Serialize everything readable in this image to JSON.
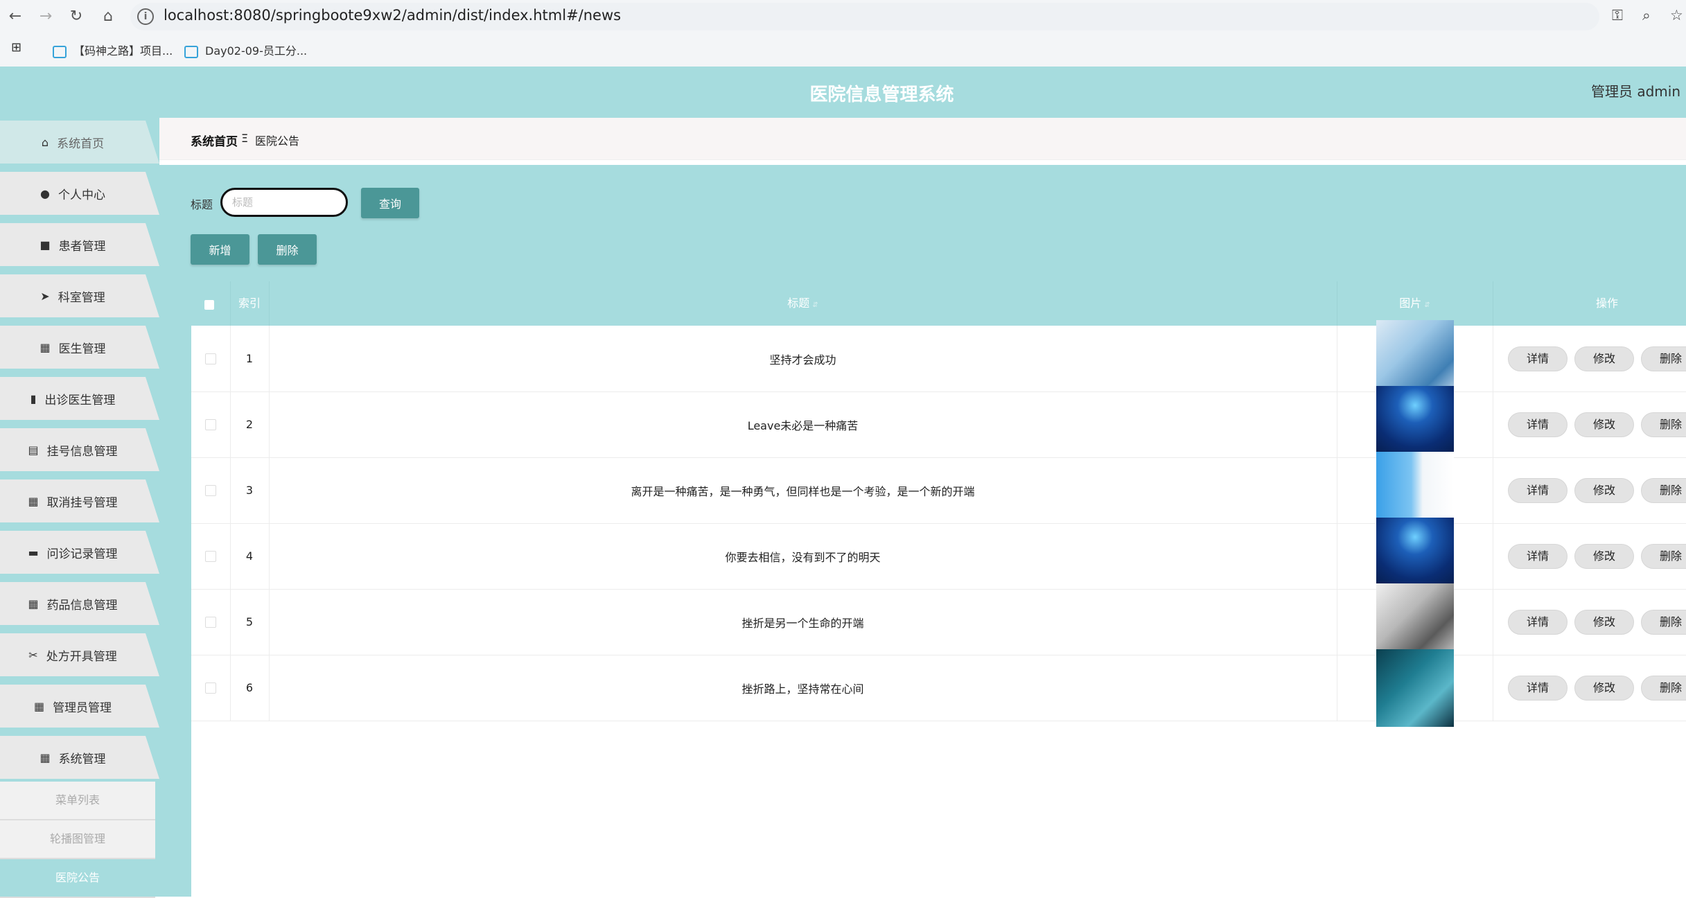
{
  "browser": {
    "url": "localhost:8080/springboote9xw2/admin/dist/index.html#/news",
    "bookmarks": [
      "【码神之路】项目...",
      "Day02-09-员工分..."
    ]
  },
  "app": {
    "title": "医院信息管理系统",
    "user_label": "管理员 admin"
  },
  "sidebar": {
    "items": [
      {
        "label": "系统首页",
        "icon": "home-icon",
        "glyph": "⌂"
      },
      {
        "label": "个人中心",
        "icon": "user-icon",
        "glyph": "●"
      },
      {
        "label": "患者管理",
        "icon": "briefcase-icon",
        "glyph": "■"
      },
      {
        "label": "科室管理",
        "icon": "paper-plane-icon",
        "glyph": "➤"
      },
      {
        "label": "医生管理",
        "icon": "grid-icon",
        "glyph": "▦"
      },
      {
        "label": "出诊医生管理",
        "icon": "bar-chart-icon",
        "glyph": "▮"
      },
      {
        "label": "挂号信息管理",
        "icon": "clipboard-icon",
        "glyph": "▤"
      },
      {
        "label": "取消挂号管理",
        "icon": "grid-icon",
        "glyph": "▦"
      },
      {
        "label": "问诊记录管理",
        "icon": "monitor-icon",
        "glyph": "▬"
      },
      {
        "label": "药品信息管理",
        "icon": "grid-icon",
        "glyph": "▦"
      },
      {
        "label": "处方开具管理",
        "icon": "ticket-icon",
        "glyph": "✂"
      },
      {
        "label": "管理员管理",
        "icon": "grid-icon",
        "glyph": "▦"
      },
      {
        "label": "系统管理",
        "icon": "grid-icon",
        "glyph": "▦"
      }
    ],
    "submenu": [
      "菜单列表",
      "轮播图管理",
      "医院公告"
    ]
  },
  "breadcrumb": {
    "home": "系统首页",
    "separator": "Ξ",
    "current": "医院公告"
  },
  "search": {
    "label": "标题",
    "placeholder": "标题",
    "button": "查询"
  },
  "actions": {
    "add": "新增",
    "delete": "删除"
  },
  "table": {
    "columns": {
      "index": "索引",
      "title": "标题",
      "image": "图片",
      "operations": "操作"
    },
    "row_buttons": {
      "detail": "详情",
      "edit": "修改",
      "delete": "删除"
    },
    "rows": [
      {
        "index": "1",
        "title": "坚持才会成功",
        "image": "doctor-hand"
      },
      {
        "index": "2",
        "title": "Leave未必是一种痛苦",
        "image": "tech-blue"
      },
      {
        "index": "3",
        "title": "离开是一种痛苦，是一种勇气，但同样也是一个考验，是一个新的开端",
        "image": "doctor-hex"
      },
      {
        "index": "4",
        "title": "你要去相信，没有到不了的明天",
        "image": "tech-blue"
      },
      {
        "index": "5",
        "title": "挫折是另一个生命的开端",
        "image": "dental"
      },
      {
        "index": "6",
        "title": "挫折路上，坚持常在心间",
        "image": "lab"
      }
    ]
  },
  "colors": {
    "theme": "#a6dcde",
    "button": "#4b9797",
    "menu_bg": "#e9e9e9"
  }
}
